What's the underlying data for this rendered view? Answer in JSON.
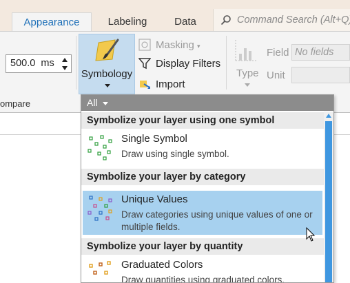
{
  "tabs": [
    {
      "label": "Appearance",
      "active": true
    },
    {
      "label": "Labeling",
      "active": false
    },
    {
      "label": "Data",
      "active": false
    }
  ],
  "search": {
    "placeholder": "Command Search (Alt+Q)"
  },
  "compare_group": {
    "duration_value": "500.0",
    "duration_unit": "ms",
    "label": "ompare"
  },
  "drawing_group": {
    "symbology_label": "Symbology",
    "masking_label": "Masking",
    "display_filters_label": "Display Filters",
    "import_label": "Import"
  },
  "field_group": {
    "type_label": "Type",
    "field_label": "Field",
    "field_value": "No fields",
    "unit_label": "Unit"
  },
  "popup": {
    "filter": "All",
    "sections": [
      {
        "heading": "Symbolize your layer using one symbol",
        "items": [
          {
            "title": "Single Symbol",
            "description": "Draw using single symbol.",
            "icon": "single-symbol-icon",
            "selected": false
          }
        ]
      },
      {
        "heading": "Symbolize your layer by category",
        "items": [
          {
            "title": "Unique Values",
            "description": "Draw categories using unique values of one or multiple fields.",
            "icon": "unique-values-icon",
            "selected": true
          }
        ]
      },
      {
        "heading": "Symbolize your layer by quantity",
        "items": [
          {
            "title": "Graduated Colors",
            "description": "Draw quantities using graduated colors.",
            "icon": "graduated-colors-icon",
            "selected": false
          }
        ]
      }
    ]
  },
  "colors": {
    "accent": "#1d6fb8",
    "selection": "#a7d1ef",
    "scrollbar": "#3f97e0",
    "symbology_button": "#c5dcef",
    "titlebar": "#f3e9df"
  }
}
